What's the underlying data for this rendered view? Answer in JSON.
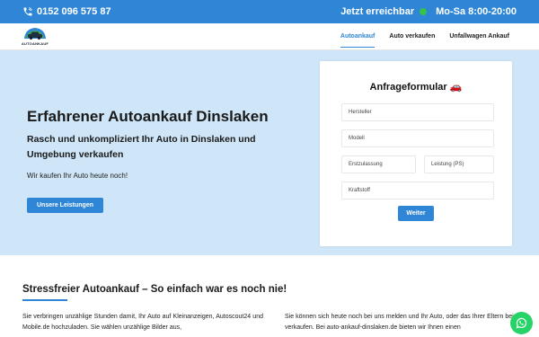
{
  "topbar": {
    "phone": "0152 096 575 87",
    "availability": "Jetzt erreichbar",
    "hours": "Mo-Sa 8:00-20:00",
    "status_color": "#37c24a"
  },
  "nav": {
    "logo_text": "AUTOANKAUF",
    "items": [
      {
        "label": "Autoankauf",
        "active": true
      },
      {
        "label": "Auto verkaufen",
        "active": false
      },
      {
        "label": "Unfallwagen Ankauf",
        "active": false
      }
    ]
  },
  "hero": {
    "title": "Erfahrener Autoankauf Dinslaken",
    "subtitle": "Rasch und unkompliziert Ihr Auto in Dinslaken und Umgebung verkaufen",
    "text": "Wir kaufen Ihr Auto heute noch!",
    "button": "Unsere Leistungen"
  },
  "form": {
    "title": "Anfrageformular 🚗",
    "fields": {
      "hersteller": "Hersteller",
      "modell": "Modell",
      "erstzulassung": "Erstzulassung",
      "leistung": "Leistung (PS)",
      "kraftstoff": "Kraftstoff"
    },
    "submit": "Weiter"
  },
  "section": {
    "title": "Stressfreier Autoankauf – So einfach war es noch nie!",
    "left": "Sie verbringen unzählige Stunden damit, Ihr Auto auf Kleinanzeigen, Autoscout24 und Mobile.de hochzuladen. Sie wählen unzählige Bilder aus,",
    "right": "Sie können sich heute noch bei uns melden und Ihr Auto, oder das Ihrer Eltern bei uns verkaufen. Bei auto-ankauf-dinslaken.de bieten wir Ihnen einen"
  },
  "colors": {
    "accent": "#2f86d6",
    "hero_bg": "#cfe6f8",
    "whatsapp": "#25d366"
  }
}
